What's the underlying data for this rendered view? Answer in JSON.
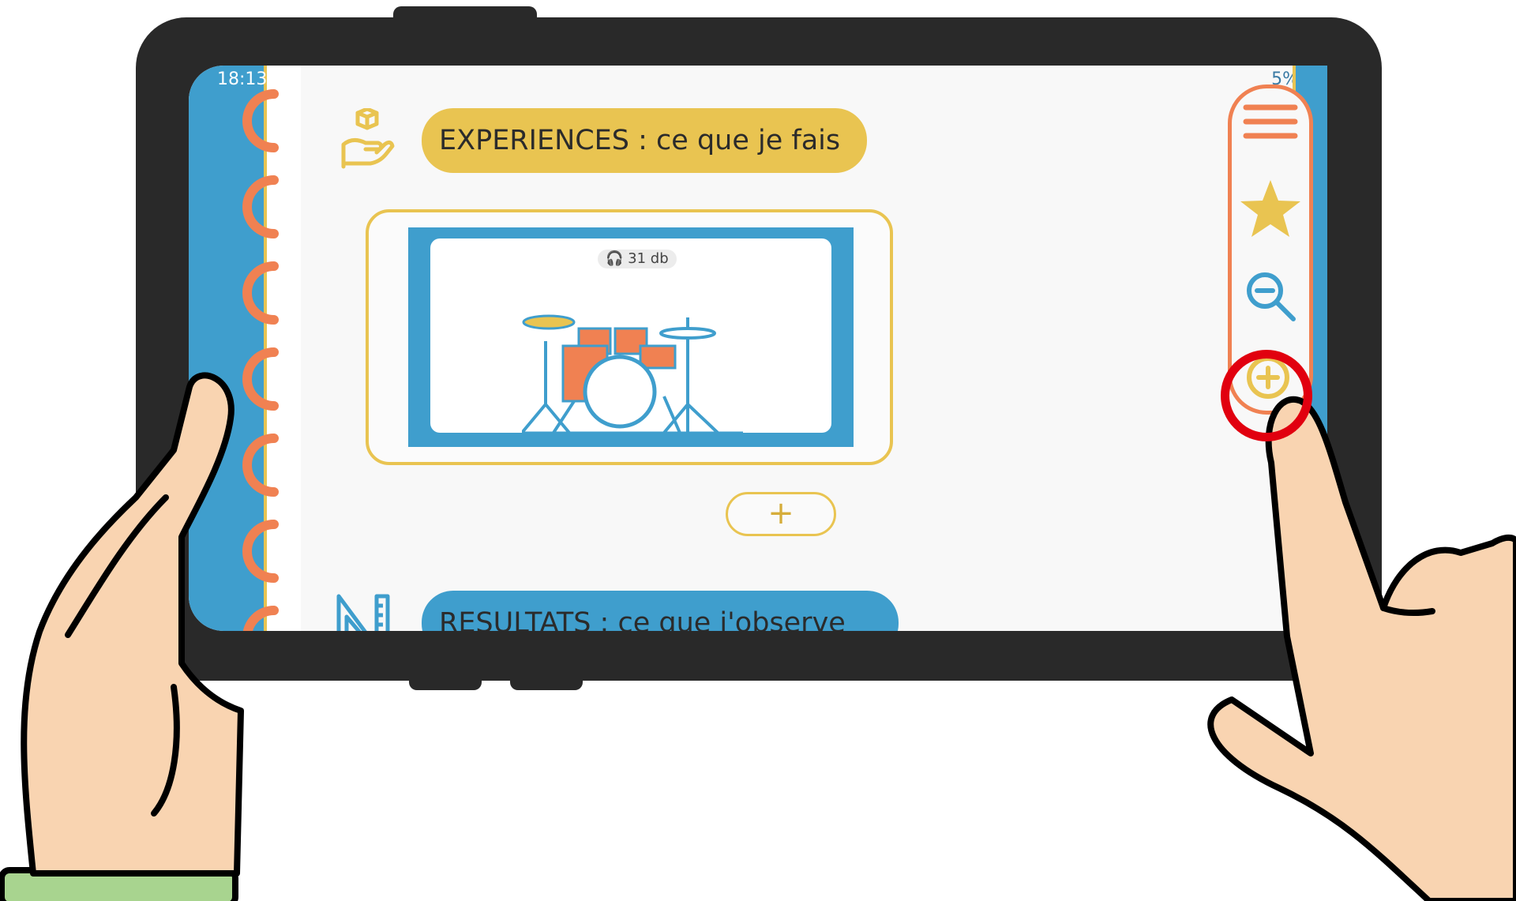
{
  "colors": {
    "frame": "#292929",
    "screen_bg": "#f8f8f8",
    "blue": "#3f9ecd",
    "yellow": "#e9c451",
    "orange": "#f08152",
    "skin": "#f9d4b1",
    "sleeve": "#a8d48f",
    "highlight_red": "#e1000f"
  },
  "status_bar": {
    "time": "18:13",
    "battery": "5%"
  },
  "sections": {
    "experiences": {
      "label": "EXPERIENCES : ce que je fais",
      "icon": "hand-holding-box-icon"
    },
    "resultats": {
      "label": "RESULTATS : ce que j'observe",
      "icon": "ruler-triangle-icon"
    }
  },
  "media_card": {
    "audio_label": "31 db",
    "audio_icon": "headphones-icon",
    "image": "drum-kit"
  },
  "add_button": {
    "label": "+"
  },
  "toolbar": {
    "items": [
      {
        "icon": "hamburger-menu-icon"
      },
      {
        "icon": "star-icon"
      },
      {
        "icon": "zoom-out-icon"
      },
      {
        "icon": "zoom-in-icon"
      }
    ]
  }
}
